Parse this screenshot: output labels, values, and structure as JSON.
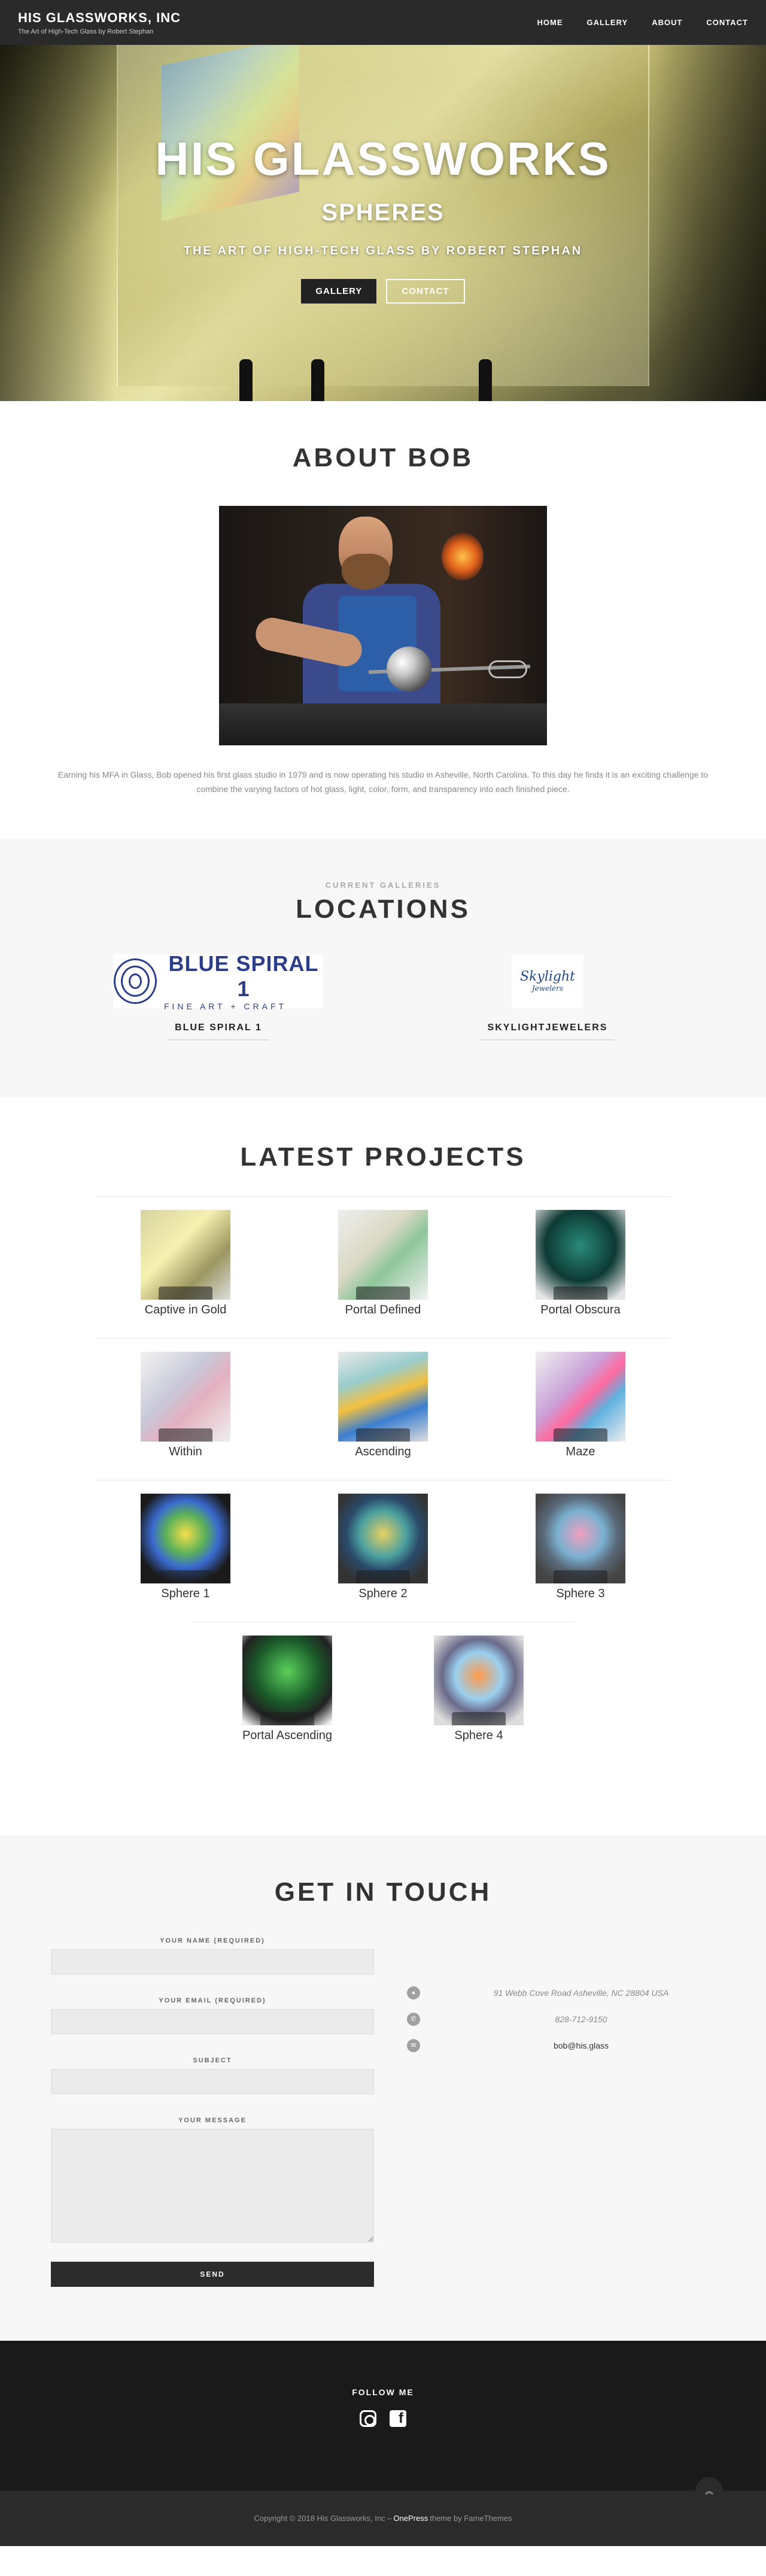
{
  "header": {
    "title": "HIS GLASSWORKS, INC",
    "tagline": "The Art of High-Tech Glass by Robert Stephan",
    "nav": [
      "HOME",
      "GALLERY",
      "ABOUT",
      "CONTACT"
    ]
  },
  "hero": {
    "title": "HIS GLASSWORKS",
    "subtitle": "SPHERES",
    "tagline": "THE ART OF HIGH-TECH GLASS BY ROBERT STEPHAN",
    "buttons": [
      "GALLERY",
      "CONTACT"
    ]
  },
  "about": {
    "title": "ABOUT BOB",
    "text": "Earning his MFA in Glass, Bob opened his first glass studio in 1979 and is now operating his studio in Asheville, North Carolina. To this day he finds it is an exciting challenge to combine the varying factors of hot glass, light, color, form, and transparency into each finished piece."
  },
  "locations": {
    "eyebrow": "CURRENT GALLERIES",
    "title": "LOCATIONS",
    "items": [
      {
        "logo_text": "BLUE SPIRAL 1",
        "logo_sub": "FINE ART + CRAFT",
        "name": "BLUE SPIRAL 1"
      },
      {
        "logo_text": "Skylight",
        "logo_sub": "Jewelers",
        "name": "SKYLIGHTJEWELERS"
      }
    ]
  },
  "projects": {
    "title": "LATEST PROJECTS",
    "rows": [
      [
        "Captive in Gold",
        "Portal Defined",
        "Portal Obscura"
      ],
      [
        "Within",
        "Ascending",
        "Maze"
      ],
      [
        "Sphere 1",
        "Sphere 2",
        "Sphere 3"
      ],
      [
        "Portal Ascending",
        "Sphere 4"
      ]
    ]
  },
  "contact": {
    "title": "GET IN TOUCH",
    "form": {
      "name_label": "YOUR NAME (REQUIRED)",
      "email_label": "YOUR EMAIL (REQUIRED)",
      "subject_label": "SUBJECT",
      "message_label": "YOUR MESSAGE",
      "send_label": "SEND"
    },
    "info": {
      "address": "91 Webb Cove Road Asheville, NC 28804 USA",
      "phone": "828-712-9150",
      "email": "bob@his.glass"
    }
  },
  "footer": {
    "follow_label": "FOLLOW ME",
    "copyright_prefix": "Copyright © 2018 His Glassworks, Inc –",
    "theme_link": "OnePress",
    "theme_suffix": "theme by FameThemes"
  },
  "colors": {
    "header_bg": "#2a2a2a",
    "section_alt_bg": "#f6f7f6",
    "footer_bg": "#1a1a1a",
    "brand_blue": "#2c3e8a"
  }
}
